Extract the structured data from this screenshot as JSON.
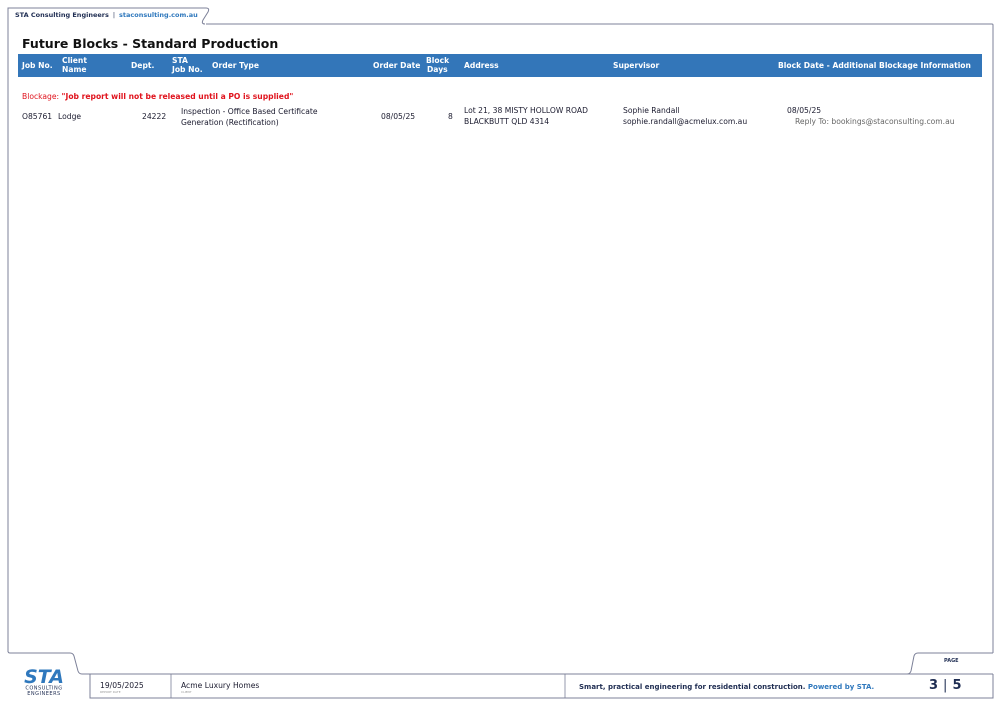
{
  "header": {
    "company": "STA Consulting Engineers",
    "separator": "|",
    "website": "staconsulting.com.au"
  },
  "page_title": "Future Blocks - Standard Production",
  "table": {
    "columns": {
      "job_no": "Job No.",
      "client_name_1": "Client",
      "client_name_2": "Name",
      "dept": "Dept.",
      "sta_job_1": "STA",
      "sta_job_2": "Job No.",
      "order_type": "Order Type",
      "order_date": "Order Date",
      "block_days_1": "Block",
      "block_days_2": "Days",
      "address": "Address",
      "supervisor": "Supervisor",
      "block_info": "Block Date - Additional Blockage Information"
    },
    "blockage": {
      "label": "Blockage:",
      "message": "\"Job report will not be released until a PO is supplied\""
    },
    "rows": [
      {
        "job_no": "O85761",
        "client_name": "Lodge",
        "dept": "24222",
        "order_type_1": "Inspection - Office Based Certificate",
        "order_type_2": "Generation (Rectification)",
        "order_date": "08/05/25",
        "block_days": "8",
        "address_1": "Lot 21, 38 MISTY HOLLOW ROAD",
        "address_2": "BLACKBUTT QLD 4314",
        "supervisor_name": "Sophie Randall",
        "supervisor_email": "sophie.randall@acmelux.com.au",
        "block_date": "08/05/25",
        "reply_to": "Reply To: bookings@staconsulting.com.au"
      }
    ]
  },
  "footer": {
    "logo_text": "STA",
    "logo_sub_1": "CONSULTING",
    "logo_sub_2": "ENGINEERS",
    "report_date": "19/05/2025",
    "report_date_caption": "REPORT DATE",
    "client": "Acme Luxury Homes",
    "client_caption": "CLIENT",
    "tagline": "Smart, practical engineering for residential construction.",
    "tagline_powered": "Powered by STA.",
    "page_label": "PAGE",
    "page_current": "3",
    "page_separator": "|",
    "page_total": "5"
  },
  "colors": {
    "header_blue": "#3376b9",
    "navy": "#1f2d52",
    "accent_blue": "#2f78bd",
    "blockage_red": "#e0131d"
  }
}
